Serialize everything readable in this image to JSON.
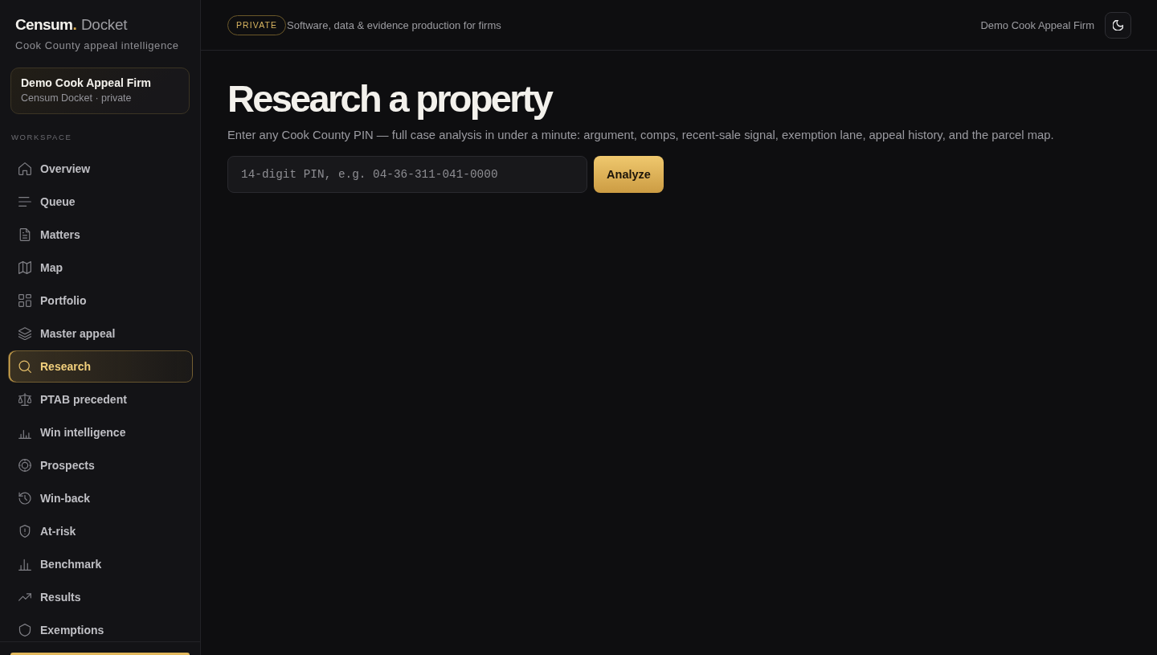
{
  "sidebar": {
    "brand": {
      "name": "Censum",
      "dot": ".",
      "product": "Docket"
    },
    "tagline": "Cook County appeal intelligence",
    "account_card": {
      "name": "Demo Cook Appeal Firm",
      "detail": "Censum Docket · private"
    },
    "section_label": "WORKSPACE",
    "items": [
      {
        "label": "Overview",
        "selected": false
      },
      {
        "label": "Queue",
        "selected": false
      },
      {
        "label": "Matters",
        "selected": false
      },
      {
        "label": "Map",
        "selected": false
      },
      {
        "label": "Portfolio",
        "selected": false
      },
      {
        "label": "Master appeal",
        "selected": false
      },
      {
        "label": "Research",
        "selected": true
      },
      {
        "label": "PTAB precedent",
        "selected": false
      },
      {
        "label": "Win intelligence",
        "selected": false
      },
      {
        "label": "Prospects",
        "selected": false
      },
      {
        "label": "Win-back",
        "selected": false
      },
      {
        "label": "At-risk",
        "selected": false
      },
      {
        "label": "Benchmark",
        "selected": false
      },
      {
        "label": "Results",
        "selected": false
      },
      {
        "label": "Exemptions",
        "selected": false
      }
    ]
  },
  "top_bar": {
    "badge": "PRIVATE",
    "tagline": "Software, data & evidence production for firms",
    "account": "Demo Cook Appeal Firm"
  },
  "research": {
    "title": "Research a property",
    "description": "Enter any Cook County PIN — full case analysis in under a minute: argument, comps, recent-sale signal, exemption lane, appeal history, and the parcel map.",
    "pin_field": {
      "placeholder": "14-digit PIN, e.g. 04-36-311-041-0000"
    },
    "analyze_button": "Analyze"
  }
}
